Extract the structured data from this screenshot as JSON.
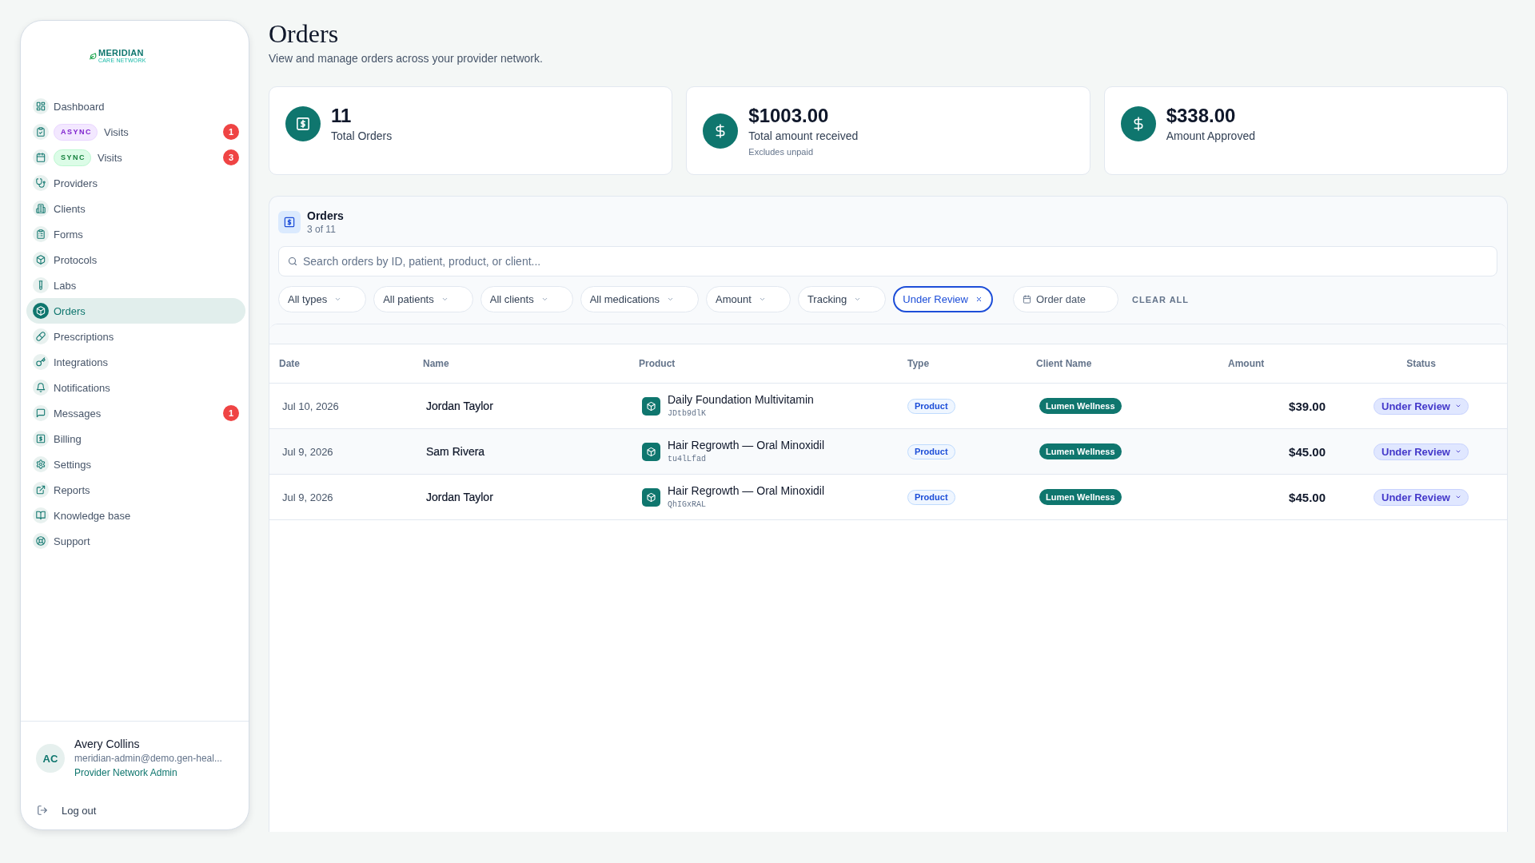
{
  "sidebar": {
    "logo": {
      "name": "MERIDIAN",
      "tagline": "CARE NETWORK"
    },
    "nav_items": [
      {
        "label": "Dashboard",
        "selected": false
      },
      {
        "label": "Visits",
        "tag": {
          "label": "ASYNC",
          "kind": "async"
        },
        "badge": "1",
        "selected": false
      },
      {
        "label": "Visits",
        "tag": {
          "label": "SYNC",
          "kind": "sync"
        },
        "badge": "3",
        "selected": false
      },
      {
        "label": "Providers",
        "selected": false
      },
      {
        "label": "Clients",
        "selected": false
      },
      {
        "label": "Forms",
        "selected": false
      },
      {
        "label": "Protocols",
        "selected": false
      },
      {
        "label": "Labs",
        "selected": false
      },
      {
        "label": "Orders",
        "selected": true
      },
      {
        "label": "Prescriptions",
        "selected": false
      },
      {
        "label": "Integrations",
        "selected": false
      },
      {
        "label": "Notifications",
        "selected": false
      },
      {
        "label": "Messages",
        "badge": "1",
        "selected": false
      },
      {
        "label": "Billing",
        "selected": false
      },
      {
        "label": "Settings",
        "selected": false
      },
      {
        "label": "Reports",
        "selected": false
      },
      {
        "label": "Knowledge base",
        "selected": false
      },
      {
        "label": "Support",
        "selected": false
      }
    ],
    "user": {
      "initials": "AC",
      "name": "Avery Collins",
      "email": "meridian-admin@demo.gen-heal...",
      "role": "Provider Network Admin"
    },
    "logout": {
      "label": "Log out"
    }
  },
  "header": {
    "title": "Orders",
    "subtitle": "View and manage orders across your provider network."
  },
  "stats": [
    {
      "value": "11",
      "label": "Total Orders"
    },
    {
      "value": "$1003.00",
      "label": "Total amount received",
      "note": "Excludes unpaid"
    },
    {
      "value": "$338.00",
      "label": "Amount Approved"
    }
  ],
  "orders_panel": {
    "title": "Orders",
    "count": "3 of 11",
    "search": {
      "placeholder": "Search orders by ID, patient, product, or client..."
    },
    "filters": [
      {
        "label": "All types",
        "kind": "dropdown",
        "selected": false
      },
      {
        "label": "All patients",
        "kind": "dropdown",
        "selected": false
      },
      {
        "label": "All clients",
        "kind": "dropdown",
        "selected": false
      },
      {
        "label": "All medications",
        "kind": "dropdown",
        "selected": false
      },
      {
        "label": "Amount",
        "kind": "dropdown",
        "selected": false
      },
      {
        "label": "Tracking",
        "kind": "dropdown",
        "selected": false
      },
      {
        "label": "Under Review",
        "kind": "chip",
        "selected": true
      },
      {
        "label": "Order date",
        "kind": "date",
        "selected": false
      }
    ],
    "clear_all": "CLEAR ALL",
    "table": {
      "columns": [
        "Date",
        "Name",
        "Product",
        "Type",
        "Client Name",
        "Amount",
        "Status"
      ],
      "rows": [
        {
          "date": "Jul 10, 2026",
          "name": "Jordan Taylor",
          "product": "Daily Foundation Multivitamin",
          "product_code": "JDtb9dlK",
          "type": "Product",
          "client": "Lumen Wellness",
          "amount": "$39.00",
          "status": "Under Review"
        },
        {
          "date": "Jul 9, 2026",
          "name": "Sam Rivera",
          "product": "Hair Regrowth — Oral Minoxidil",
          "product_code": "tu4lLfad",
          "type": "Product",
          "client": "Lumen Wellness",
          "amount": "$45.00",
          "status": "Under Review"
        },
        {
          "date": "Jul 9, 2026",
          "name": "Jordan Taylor",
          "product": "Hair Regrowth — Oral Minoxidil",
          "product_code": "QhIGxRAL",
          "type": "Product",
          "client": "Lumen Wellness",
          "amount": "$45.00",
          "status": "Under Review"
        }
      ]
    }
  }
}
